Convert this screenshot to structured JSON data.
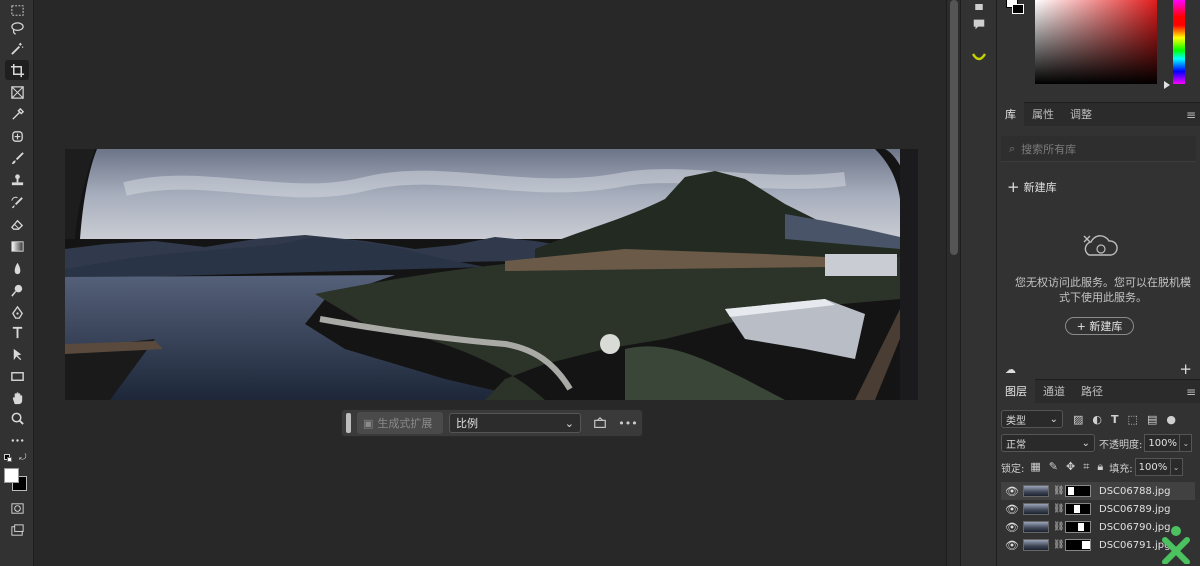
{
  "ctxbar": {
    "generative_expand": "生成式扩展",
    "ratio_select": "比例"
  },
  "library": {
    "tabs": [
      "库",
      "属性",
      "调整"
    ],
    "search_placeholder": "搜索所有库",
    "new_library": "新建库",
    "message": "您无权访问此服务。您可以在脱机模式下使用此服务。",
    "new_library_button": "+ 新建库"
  },
  "layers": {
    "tabs": [
      "图层",
      "通道",
      "路径"
    ],
    "filter_kind": "类型",
    "blend_mode": "正常",
    "opacity_label": "不透明度:",
    "opacity_value": "100%",
    "lock_label": "锁定:",
    "fill_label": "填充:",
    "fill_value": "100%",
    "items": [
      {
        "name": "DSC06788.jpg"
      },
      {
        "name": "DSC06789.jpg"
      },
      {
        "name": "DSC06790.jpg"
      },
      {
        "name": "DSC06791.jpg"
      }
    ]
  },
  "colors": {
    "accent_green": "#4bc25f",
    "panel": "#323232",
    "canvas": "#282828"
  }
}
